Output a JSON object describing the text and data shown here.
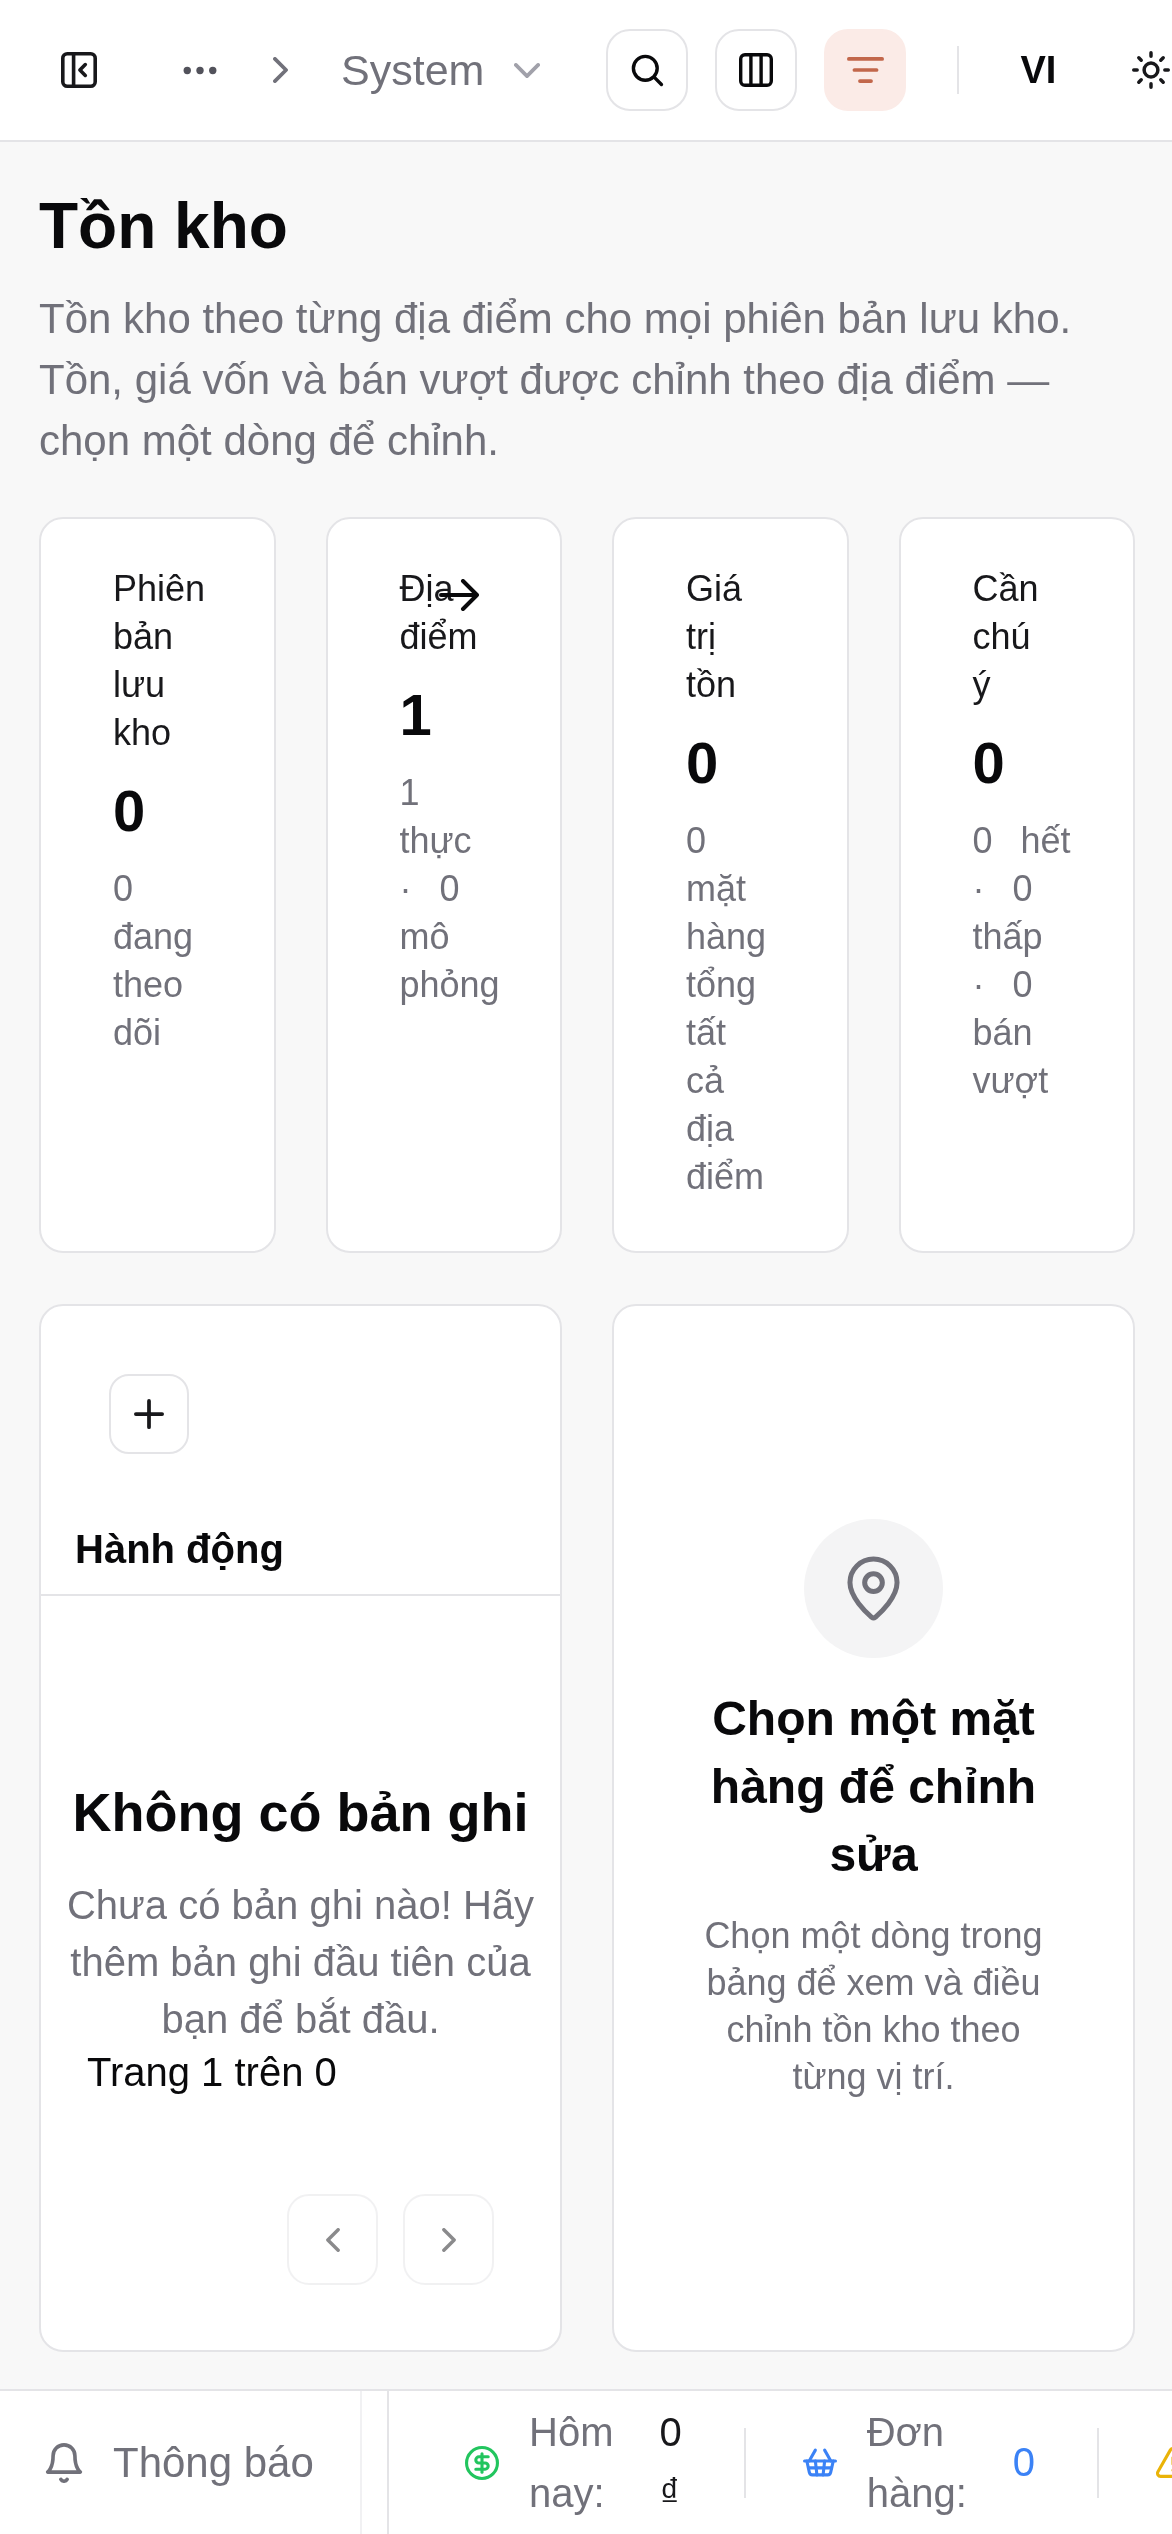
{
  "top_bar": {
    "breadcrumb_current": "System",
    "toolbar_buttons": [
      {
        "kind": "search",
        "active": false
      },
      {
        "kind": "columns",
        "active": false
      },
      {
        "kind": "filter",
        "active": true
      }
    ],
    "language": "VI"
  },
  "page": {
    "title": "Tồn kho",
    "description": "Tồn kho theo từng địa điểm cho mọi phiên bản lưu kho. Tồn, giá vốn và bán vượt được chỉnh theo địa điểm — chọn một dòng để chỉnh."
  },
  "stats": [
    {
      "label": "Phiên bản lưu kho",
      "value": "0",
      "detail": "0 đang theo dõi",
      "arrow": false
    },
    {
      "label": "Địa điểm",
      "value": "1",
      "detail": "1 thực · 0 mô phỏng",
      "arrow": true
    },
    {
      "label": "Giá trị tồn",
      "value": "0",
      "detail": "0 mặt hàng tổng tất cả địa điểm",
      "arrow": false
    },
    {
      "label": "Cần chú ý",
      "value": "0",
      "detail": "0 hết · 0 thấp · 0 bán vượt",
      "arrow": false
    }
  ],
  "inventory_table": {
    "columns": [
      "Hành động"
    ],
    "empty_title": "Không có bản ghi",
    "empty_message": "Chưa có bản ghi nào! Hãy thêm bản ghi đầu tiên của bạn để bắt đầu.",
    "page_info": "Trang 1 trên 0",
    "pager": [
      {
        "kind": "previous",
        "disabled": true
      },
      {
        "kind": "next",
        "disabled": true
      }
    ]
  },
  "detail_panel": {
    "title": "Chọn một mặt hàng để chỉnh sửa",
    "message": "Chọn một dòng trong bảng để xem và điều chỉnh tồn kho theo từng vị trí."
  },
  "status_bar": {
    "notifications": "Thông báo",
    "items": [
      {
        "kind": "revenue",
        "label": "Hôm nay:",
        "value": "0 ₫"
      },
      {
        "kind": "orders",
        "label": "Đơn hàng:",
        "value": "0"
      },
      {
        "kind": "warning"
      }
    ]
  }
}
